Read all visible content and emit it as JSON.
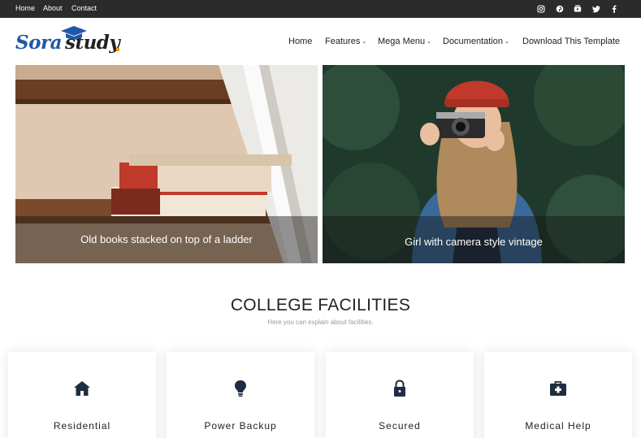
{
  "topbar": {
    "links": [
      "Home",
      "About",
      "Contact"
    ],
    "social": [
      "instagram-icon",
      "pinterest-icon",
      "youtube-icon",
      "twitter-icon",
      "facebook-icon"
    ]
  },
  "header": {
    "logo_part1": "Sora",
    "logo_part2": "study",
    "nav": {
      "home": "Home",
      "features": "Features",
      "mega_menu": "Mega Menu",
      "documentation": "Documentation",
      "download": "Download This Template"
    }
  },
  "slides": [
    {
      "caption": "Old books stacked on top of a ladder"
    },
    {
      "caption": "Girl with camera style vintage"
    }
  ],
  "facilities": {
    "title": "COLLEGE FACILITIES",
    "subtitle": "Here you can explain about facilities.",
    "cards": [
      {
        "label": "Residential",
        "icon": "home-icon"
      },
      {
        "label": "Power Backup",
        "icon": "lightbulb-icon"
      },
      {
        "label": "Secured",
        "icon": "lock-icon"
      },
      {
        "label": "Medical Help",
        "icon": "medical-kit-icon"
      }
    ]
  },
  "colors": {
    "topbar": "#2b2b2b",
    "brand_blue": "#1f58a8",
    "accent_yellow": "#f0a000",
    "text_dark": "#222222"
  }
}
